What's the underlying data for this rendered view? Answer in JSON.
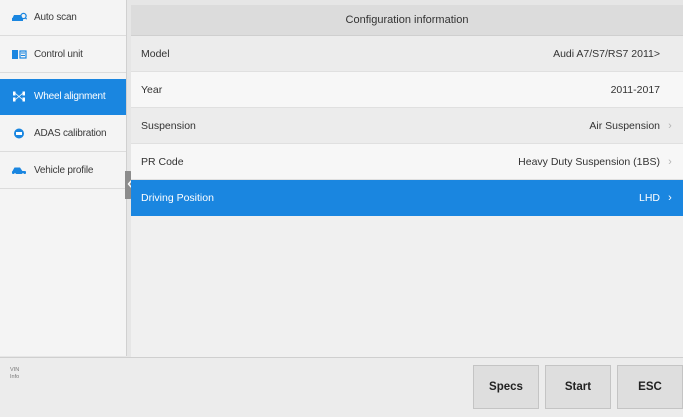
{
  "sidebar": {
    "items": [
      {
        "label": "Auto scan",
        "icon": "car-scan-icon",
        "active": false
      },
      {
        "label": "Control unit",
        "icon": "ecu-icon",
        "active": false
      },
      {
        "label": "Wheel alignment",
        "icon": "wheel-alignment-icon",
        "active": true
      },
      {
        "label": "ADAS calibration",
        "icon": "adas-icon",
        "active": false
      },
      {
        "label": "Vehicle profile",
        "icon": "car-profile-icon",
        "active": false
      }
    ]
  },
  "panel": {
    "title": "Configuration information",
    "rows": [
      {
        "label": "Model",
        "value": "Audi A7/S7/RS7 2011>",
        "chevron": false
      },
      {
        "label": "Year",
        "value": "2011-2017",
        "chevron": false
      },
      {
        "label": "Suspension",
        "value": "Air Suspension",
        "chevron": true
      },
      {
        "label": "PR Code",
        "value": "Heavy Duty Suspension (1BS)",
        "chevron": true
      },
      {
        "label": "Driving Position",
        "value": "LHD",
        "chevron": true,
        "selected": true
      }
    ]
  },
  "bottom": {
    "vin_label": "VIN",
    "info_label": "Info",
    "buttons": {
      "specs": "Specs",
      "start": "Start",
      "esc": "ESC"
    }
  },
  "colors": {
    "accent": "#1a86e0",
    "icon": "#1a86e0"
  }
}
